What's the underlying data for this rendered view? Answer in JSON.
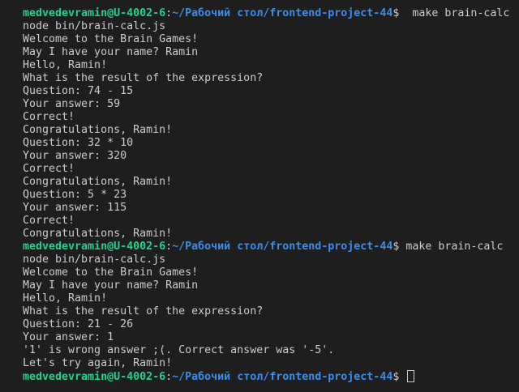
{
  "terminal": {
    "colors": {
      "background": "#1e1e1e",
      "foreground": "#cccccc",
      "user": "#23d18b",
      "path": "#3b8eea"
    },
    "prompt": {
      "user_host": "medvedevramin@U-4002-6",
      "colon": ":",
      "path": "~/Рабочий стол/frontend-project-44",
      "symbol": "$"
    },
    "run1": {
      "command": "  make brain-calc",
      "output": [
        "node bin/brain-calc.js",
        "Welcome to the Brain Games!",
        "May I have your name? Ramin",
        "Hello, Ramin!",
        "What is the result of the expression?",
        "Question: 74 - 15",
        "Your answer: 59",
        "Correct!",
        "Congratulations, Ramin!",
        "Question: 32 * 10",
        "Your answer: 320",
        "Correct!",
        "Congratulations, Ramin!",
        "Question: 5 * 23",
        "Your answer: 115",
        "Correct!",
        "Congratulations, Ramin!"
      ]
    },
    "run2": {
      "command": " make brain-calc",
      "output": [
        "node bin/brain-calc.js",
        "Welcome to the Brain Games!",
        "May I have your name? Ramin",
        "Hello, Ramin!",
        "What is the result of the expression?",
        "Question: 21 - 26",
        "Your answer: 1",
        "'1' is wrong answer ;(. Correct answer was '-5'.",
        "Let's try again, Ramin!"
      ]
    }
  }
}
